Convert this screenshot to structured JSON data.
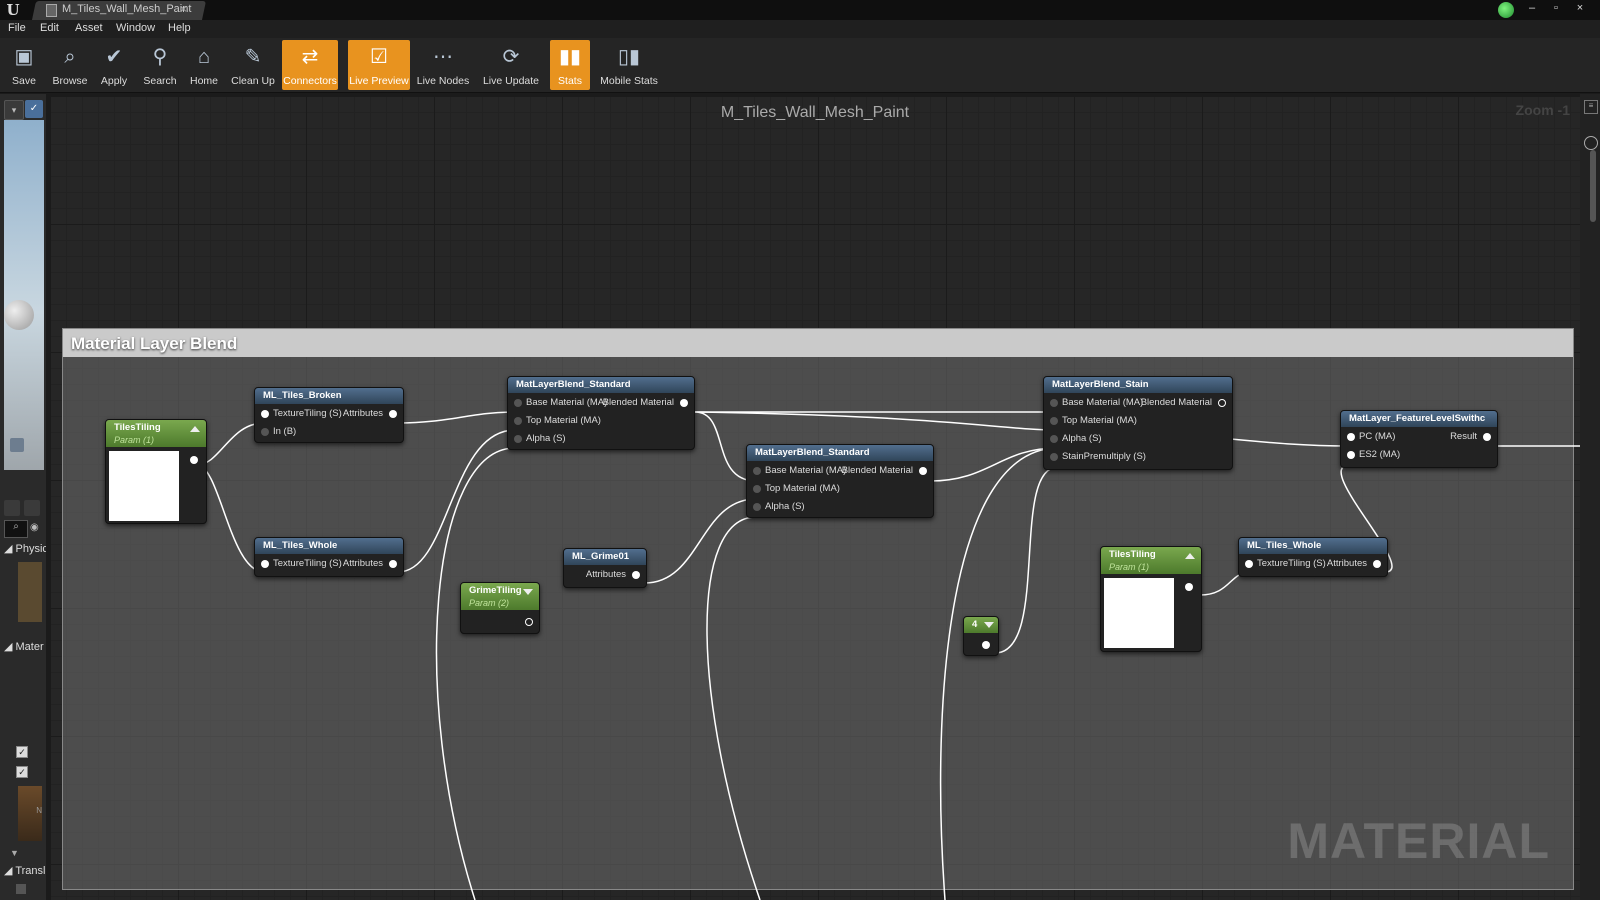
{
  "window": {
    "tab_title": "M_Tiles_Wall_Mesh_Paint",
    "tab_close": "×",
    "controls": [
      "–",
      "▫",
      "×"
    ]
  },
  "menu": [
    "File",
    "Edit",
    "Asset",
    "Window",
    "Help"
  ],
  "toolbar": [
    {
      "label": "Save",
      "icon": "save-icon",
      "active": false
    },
    {
      "label": "Browse",
      "icon": "browse-icon",
      "active": false
    },
    {
      "label": "Apply",
      "icon": "apply-icon",
      "active": false
    },
    {
      "label": "Search",
      "icon": "search-icon",
      "active": false
    },
    {
      "label": "Home",
      "icon": "home-icon",
      "active": false
    },
    {
      "label": "Clean Up",
      "icon": "cleanup-icon",
      "active": false
    },
    {
      "label": "Connectors",
      "icon": "connectors-icon",
      "active": true
    },
    {
      "label": "Live Preview",
      "icon": "live-preview-icon",
      "active": true
    },
    {
      "label": "Live Nodes",
      "icon": "live-nodes-icon",
      "active": false
    },
    {
      "label": "Live Update",
      "icon": "live-update-icon",
      "active": false
    },
    {
      "label": "Stats",
      "icon": "stats-icon",
      "active": true
    },
    {
      "label": "Mobile Stats",
      "icon": "mobile-stats-icon",
      "active": false
    }
  ],
  "left_panel": {
    "sections": [
      "Physic",
      "Mater",
      "Transl"
    ],
    "checkbox_mark": "✓",
    "thumb_label": "N"
  },
  "graph": {
    "title": "M_Tiles_Wall_Mesh_Paint",
    "zoom": "Zoom -1",
    "comment_title": "Material Layer Blend",
    "watermark": "MATERIAL"
  },
  "nodes": {
    "tiles_tiling_1": {
      "title": "TilesTiling",
      "subtitle": "Param (1)"
    },
    "ml_tiles_broken": {
      "title": "ML_Tiles_Broken",
      "in_1": "TextureTiling (S)",
      "in_2": "In (B)",
      "out_1": "Attributes"
    },
    "ml_tiles_whole_1": {
      "title": "ML_Tiles_Whole",
      "in_1": "TextureTiling (S)",
      "out_1": "Attributes"
    },
    "blend_std_1": {
      "title": "MatLayerBlend_Standard",
      "in_1": "Base Material (MA)",
      "in_2": "Top Material (MA)",
      "in_3": "Alpha (S)",
      "out_1": "Blended Material"
    },
    "blend_std_2": {
      "title": "MatLayerBlend_Standard",
      "in_1": "Base Material (MA)",
      "in_2": "Top Material (MA)",
      "in_3": "Alpha (S)",
      "out_1": "Blended Material"
    },
    "ml_grime": {
      "title": "ML_Grime01",
      "out_1": "Attributes"
    },
    "grime_tiling": {
      "title": "GrimeTiling",
      "subtitle": "Param (2)"
    },
    "blend_stain": {
      "title": "MatLayerBlend_Stain",
      "in_1": "Base Material (MA)",
      "in_2": "Top Material (MA)",
      "in_3": "Alpha (S)",
      "in_4": "StainPremultiply (S)",
      "out_1": "Blended Material"
    },
    "const_4": {
      "title": "4"
    },
    "tiles_tiling_2": {
      "title": "TilesTiling",
      "subtitle": "Param (1)"
    },
    "ml_tiles_whole_2": {
      "title": "ML_Tiles_Whole",
      "in_1": "TextureTiling (S)",
      "out_1": "Attributes"
    },
    "feature_switch": {
      "title": "MatLayer_FeatureLevelSwithc",
      "in_1": "PC (MA)",
      "in_2": "ES2 (MA)",
      "out_1": "Result"
    }
  },
  "colors": {
    "active_tool": "#e8931f",
    "node_header_blue": "#3d5670",
    "node_header_green": "#5f8f3a",
    "wire": "#ffffff"
  }
}
